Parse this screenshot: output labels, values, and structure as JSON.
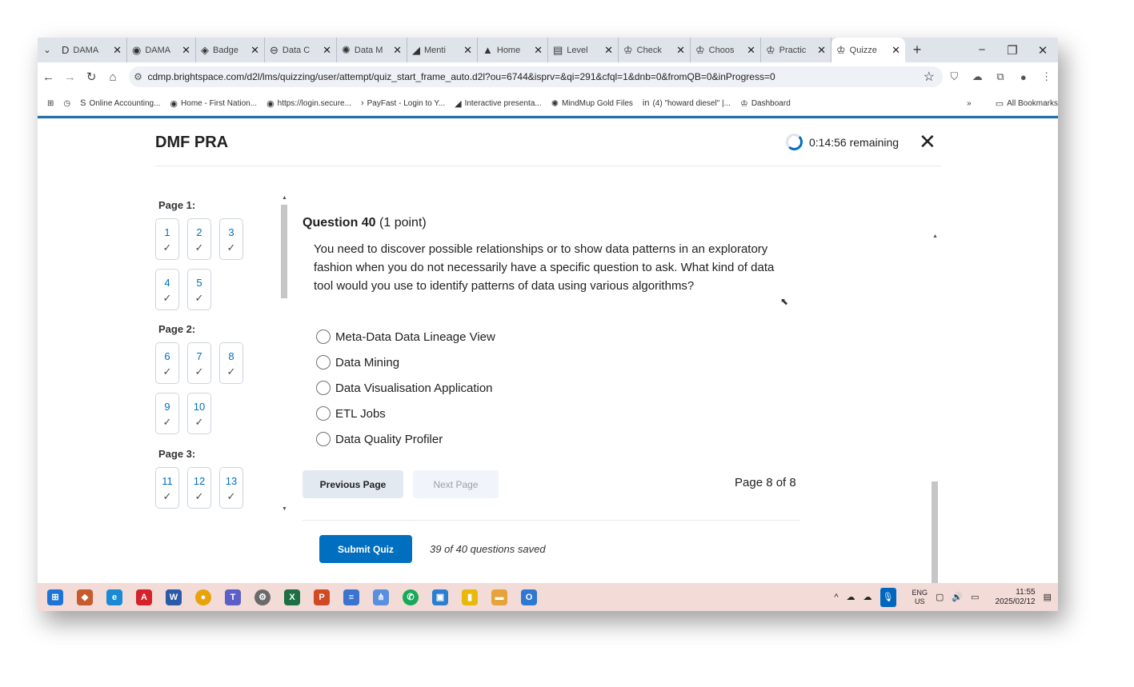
{
  "browser": {
    "tabs": [
      {
        "label": "DAMA",
        "icon": "D"
      },
      {
        "label": "DAMA",
        "icon": "◉"
      },
      {
        "label": "Badge",
        "icon": "◈"
      },
      {
        "label": "Data C",
        "icon": "⊖"
      },
      {
        "label": "Data M",
        "icon": "✺"
      },
      {
        "label": "Menti",
        "icon": "◢"
      },
      {
        "label": "Home",
        "icon": "▲"
      },
      {
        "label": "Level",
        "icon": "▤"
      },
      {
        "label": "Check",
        "icon": "♔"
      },
      {
        "label": "Choos",
        "icon": "♔"
      },
      {
        "label": "Practic",
        "icon": "♔"
      },
      {
        "label": "Quizze",
        "icon": "♔"
      }
    ],
    "url": "cdmp.brightspace.com/d2l/lms/quizzing/user/attempt/quiz_start_frame_auto.d2l?ou=6744&isprv=&qi=291&cfql=1&dnb=0&fromQB=0&inProgress=0",
    "bookmarks": [
      {
        "label": "Online Accounting...",
        "icon": "S"
      },
      {
        "label": "Home - First Nation...",
        "icon": "◉"
      },
      {
        "label": "https://login.secure...",
        "icon": "◉"
      },
      {
        "label": "PayFast - Login to Y...",
        "icon": "›"
      },
      {
        "label": "Interactive presenta...",
        "icon": "◢"
      },
      {
        "label": "MindMup Gold Files",
        "icon": "✺"
      },
      {
        "label": "(4) \"howard diesel\" |...",
        "icon": "in"
      },
      {
        "label": "Dashboard",
        "icon": "♔"
      }
    ],
    "all_bookmarks": "All Bookmarks"
  },
  "quiz": {
    "title": "DMF PRA",
    "timer": "0:14:56 remaining",
    "pages": [
      {
        "label": "Page 1:",
        "questions": [
          "1",
          "2",
          "3",
          "4",
          "5"
        ]
      },
      {
        "label": "Page 2:",
        "questions": [
          "6",
          "7",
          "8",
          "9",
          "10"
        ]
      },
      {
        "label": "Page 3:",
        "questions": [
          "11",
          "12",
          "13"
        ]
      }
    ],
    "question": {
      "number": "Question 40",
      "points": "(1 point)",
      "text": "You need to discover possible relationships or to show data patterns in an exploratory fashion when you do not necessarily have a specific question to ask. What kind of data tool would you use to identify patterns of data using various algorithms?",
      "options": [
        "Meta-Data Data Lineage View",
        "Data Mining",
        "Data Visualisation Application",
        "ETL Jobs",
        "Data Quality Profiler"
      ]
    },
    "prev_label": "Previous Page",
    "next_label": "Next Page",
    "page_info": "Page 8 of 8",
    "submit_label": "Submit Quiz",
    "saved_status": "39 of 40 questions saved"
  },
  "taskbar": {
    "lang_top": "ENG",
    "lang_bottom": "US",
    "time": "11:55",
    "date": "2025/02/12"
  }
}
